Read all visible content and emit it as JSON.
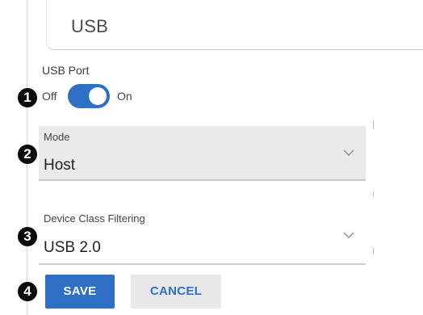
{
  "header": {
    "title": "USB"
  },
  "usb_port": {
    "label": "USB Port",
    "off_label": "Off",
    "on_label": "On",
    "state": "on"
  },
  "mode": {
    "label": "Mode",
    "value": "Host"
  },
  "device_class_filtering": {
    "label": "Device Class Filtering",
    "value": "USB 2.0"
  },
  "actions": {
    "save_label": "SAVE",
    "cancel_label": "CANCEL"
  },
  "callouts": [
    "1",
    "2",
    "3",
    "4"
  ],
  "colors": {
    "accent": "#2f6fc6",
    "field_bg": "#eaeaea",
    "cancel_bg": "#e9e9ec"
  },
  "icons": {
    "dropdown": "chevron-down-icon"
  }
}
